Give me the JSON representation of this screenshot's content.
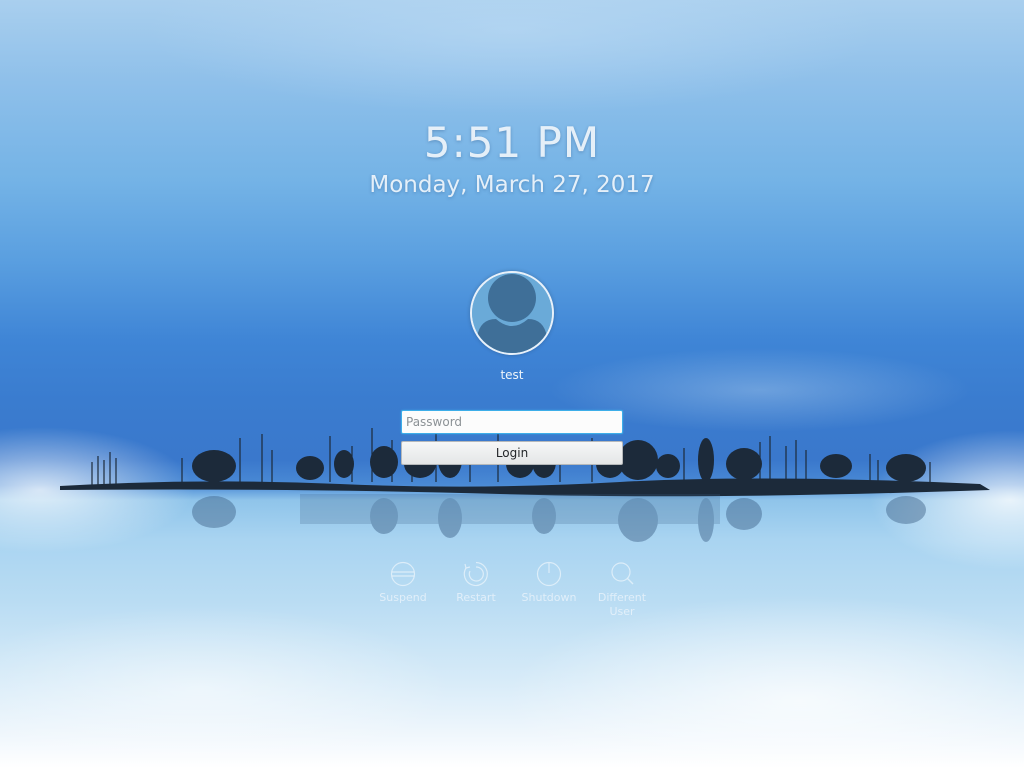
{
  "clock": {
    "time": "5:51 PM",
    "date": "Monday, March 27, 2017"
  },
  "user": {
    "name": "test",
    "avatar_icon": "user-avatar-icon"
  },
  "login": {
    "password_placeholder": "Password",
    "password_value": "",
    "button_label": "Login",
    "accent_color": "#3daee9"
  },
  "actions": [
    {
      "label": "Suspend",
      "icon": "suspend-icon"
    },
    {
      "label": "Restart",
      "icon": "restart-icon"
    },
    {
      "label": "Shutdown",
      "icon": "shutdown-icon"
    },
    {
      "label": "Different User",
      "icon": "switch-user-icon"
    }
  ]
}
